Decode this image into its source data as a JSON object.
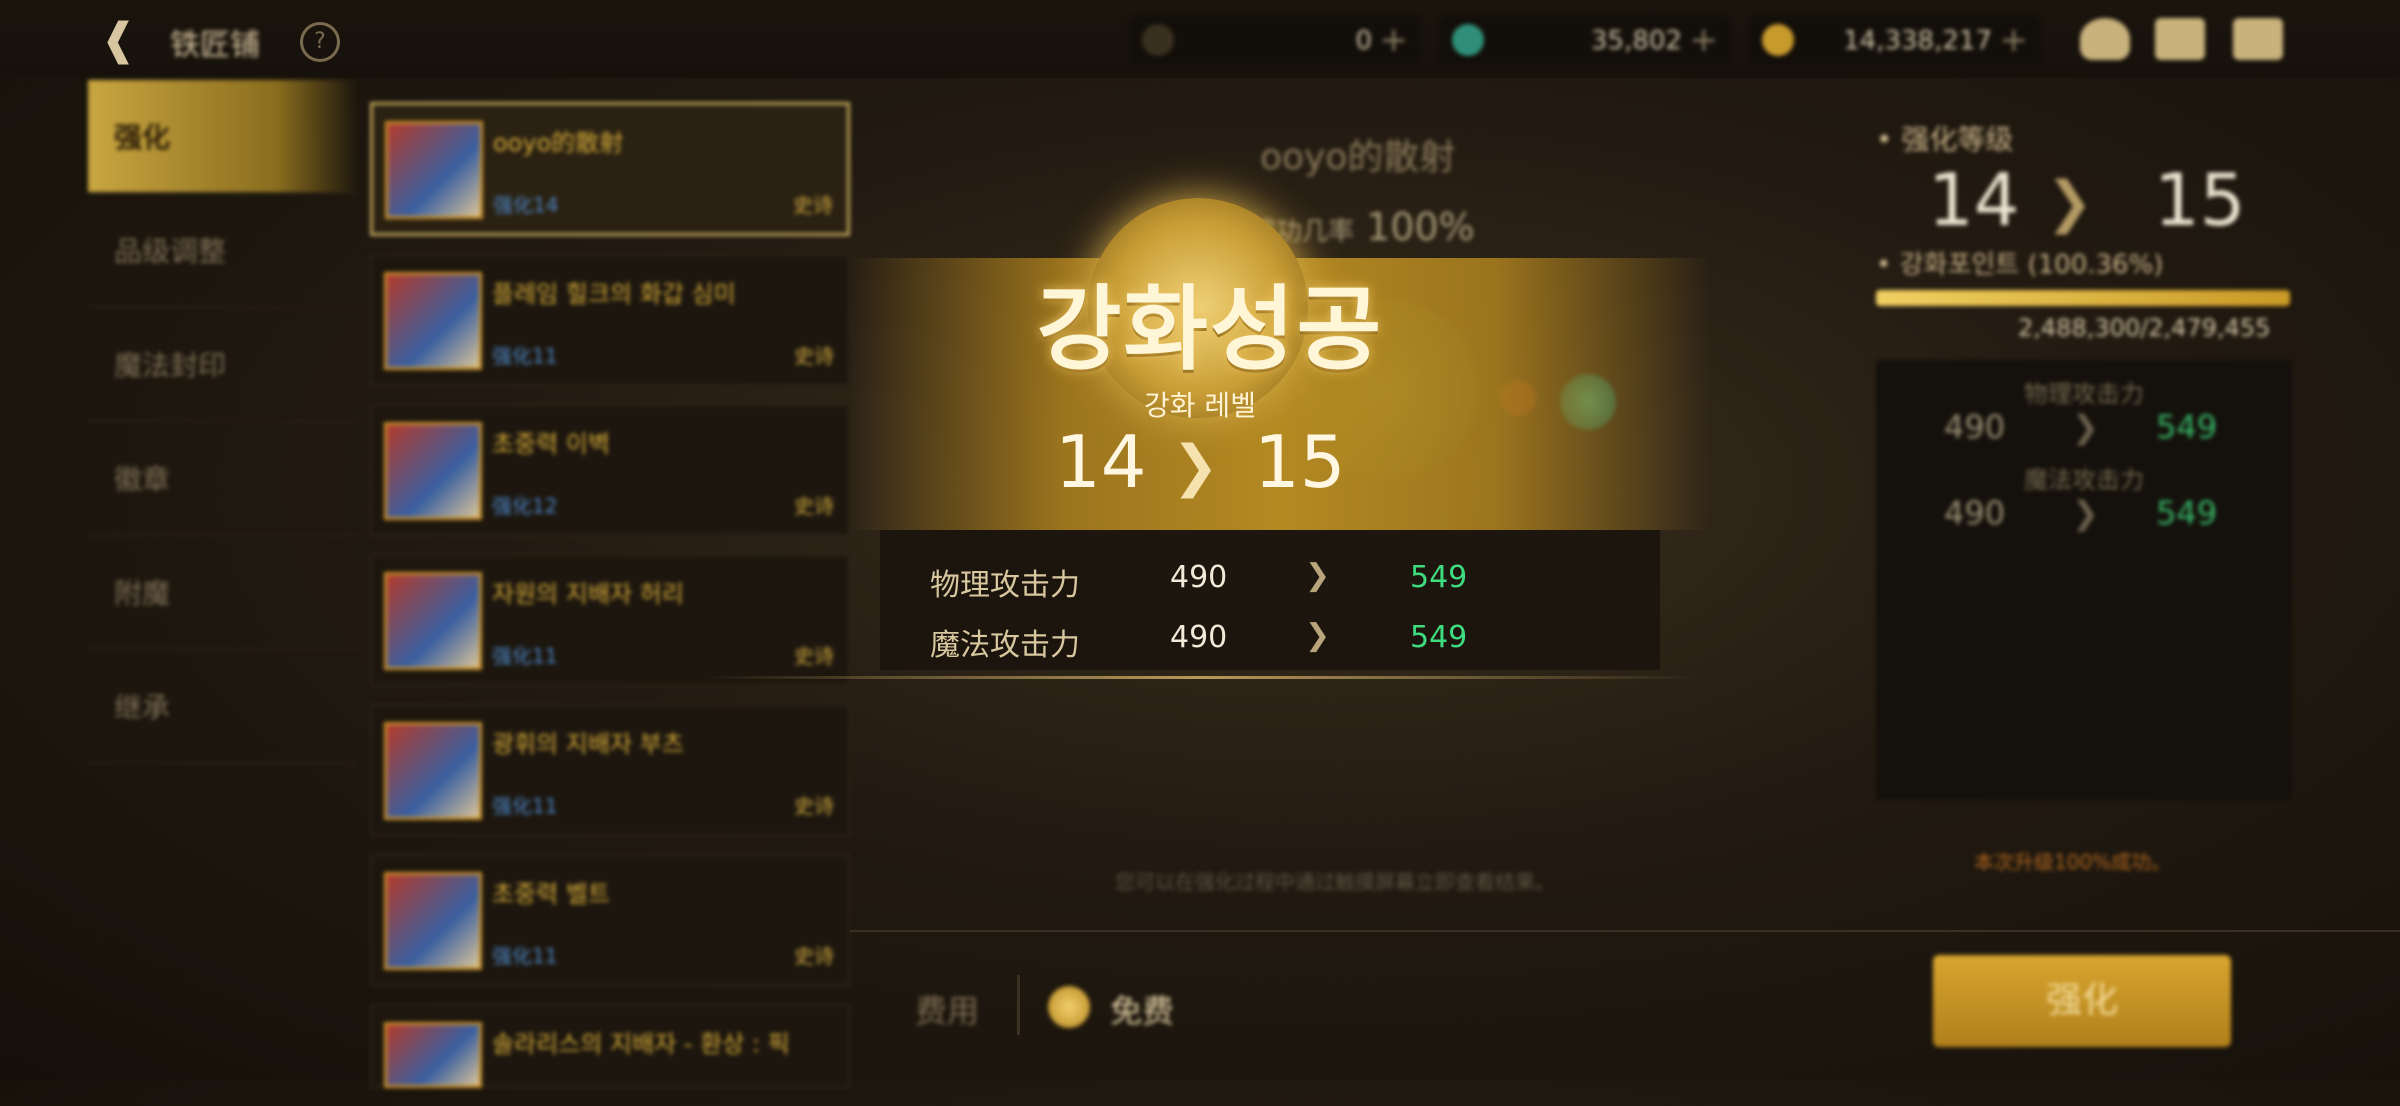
{
  "header": {
    "title": "铁匠铺",
    "resources": [
      {
        "icon": "moon-currency-icon",
        "value": "0",
        "color": "#7a6a4a"
      },
      {
        "icon": "gem-icon",
        "value": "35,802",
        "color": "#2f8f7a"
      },
      {
        "icon": "gold-coin-icon",
        "value": "14,338,217",
        "color": "#c79a2c"
      }
    ],
    "icons": [
      "bag-icon",
      "mail-icon",
      "chat-icon"
    ]
  },
  "sidebar": {
    "items": [
      {
        "label": "强化",
        "active": true
      },
      {
        "label": "品级调整",
        "active": false
      },
      {
        "label": "魔法封印",
        "active": false
      },
      {
        "label": "徽章",
        "active": false
      },
      {
        "label": "附魔",
        "active": false
      },
      {
        "label": "继承",
        "active": false
      }
    ]
  },
  "items": [
    {
      "name": "ooyo的散射",
      "level": "强化14",
      "type": "史诗",
      "selected": true
    },
    {
      "name": "플레임 힐크의 화갑 심미",
      "level": "强化11",
      "type": "史诗",
      "selected": false
    },
    {
      "name": "초중력 이벽",
      "level": "强化12",
      "type": "史诗",
      "selected": false
    },
    {
      "name": "자원의 지배자 허리",
      "level": "强化11",
      "type": "史诗",
      "selected": false
    },
    {
      "name": "광휘의 지배자 부츠",
      "level": "强化11",
      "type": "史诗",
      "selected": false
    },
    {
      "name": "초중력 벨트",
      "level": "强化11",
      "type": "史诗",
      "selected": false
    },
    {
      "name": "솔라리스의 지배자 - 환상 : 픽",
      "level": "",
      "type": "",
      "selected": false
    }
  ],
  "center": {
    "item_name": "ooyo的散射",
    "rate_label": "成功几率",
    "rate_value": "100%",
    "success_text": "강화성공",
    "level_label": "강화 레벨",
    "level_from": "14",
    "level_to": "15",
    "stats": [
      {
        "label": "物理攻击力",
        "from": "490",
        "to": "549"
      },
      {
        "label": "魔法攻击力",
        "from": "490",
        "to": "549"
      }
    ],
    "hint": "您可以在强化过程中通过触摸屏幕立即查看结果。"
  },
  "cost": {
    "label": "费用",
    "value": "免费"
  },
  "enhance_button": "强化",
  "right_panel": {
    "title": "强化等级",
    "from": "14",
    "to": "15",
    "point_label": "강화포인트 (100.36%)",
    "progress": 1.0,
    "points": "2,488,300/2,479,455",
    "stats": [
      {
        "label": "物理攻击力",
        "from": "490",
        "to": "549"
      },
      {
        "label": "魔法攻击力",
        "from": "490",
        "to": "549"
      }
    ],
    "note": "本次升级100%成功。"
  },
  "colors": {
    "accent_gold": "#c99d35",
    "stat_increase": "#3fdc7f",
    "blue_level": "#4d87c9"
  }
}
